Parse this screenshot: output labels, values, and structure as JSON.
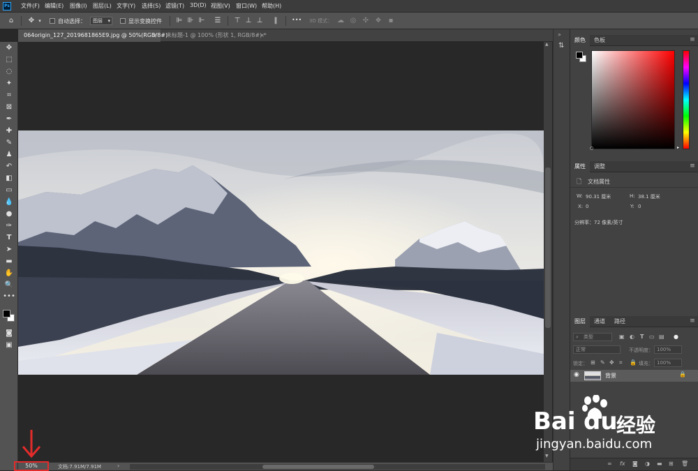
{
  "menubar": {
    "items": [
      "文件(F)",
      "编辑(E)",
      "图像(I)",
      "图层(L)",
      "文字(Y)",
      "选择(S)",
      "滤镜(T)",
      "3D(D)",
      "视图(V)",
      "窗口(W)",
      "帮助(H)"
    ]
  },
  "options": {
    "auto_select_label": "自动选择：",
    "auto_select_value": "图层",
    "show_transform_label": "显示变换控件",
    "more_label": "•••",
    "mode3d_label": "3D 模式："
  },
  "tabs": [
    {
      "label": "064origin_127_2019681865E9.jpg @ 50%(RGB/8#)",
      "close": "×"
    },
    {
      "label": "未标题-1 @ 100% (形状 1, RGB/8#) *",
      "close": "×"
    }
  ],
  "status": {
    "zoom": "50%",
    "doc": "文档:7.91M/7.91M",
    "chev": "›"
  },
  "color_panel": {
    "tabs": [
      "颜色",
      "色板"
    ],
    "fg": "#000000",
    "bg": "#ffffff",
    "hue_color": "#ff0000"
  },
  "props_panel": {
    "tabs": [
      "属性",
      "调整"
    ],
    "section": "文档属性",
    "w_label": "W:",
    "w_value": "90.31 厘米",
    "h_label": "H:",
    "h_value": "38.1 厘米",
    "x_label": "X:",
    "x_value": "0",
    "y_label": "Y:",
    "y_value": "0",
    "res_label": "分辨率：72 像素/英寸"
  },
  "layers_panel": {
    "tabs": [
      "图层",
      "通道",
      "路径"
    ],
    "kind_label": "类型",
    "blend": "正常",
    "opacity_label": "不透明度：",
    "opacity_value": "100%",
    "lock_label": "锁定：",
    "fill_label": "填充：",
    "fill_value": "100%",
    "layer_name": "背景"
  },
  "watermark": {
    "brand": "Bai",
    "brand2": "du",
    "cn": "经验",
    "url": "jingyan.baidu.com"
  }
}
